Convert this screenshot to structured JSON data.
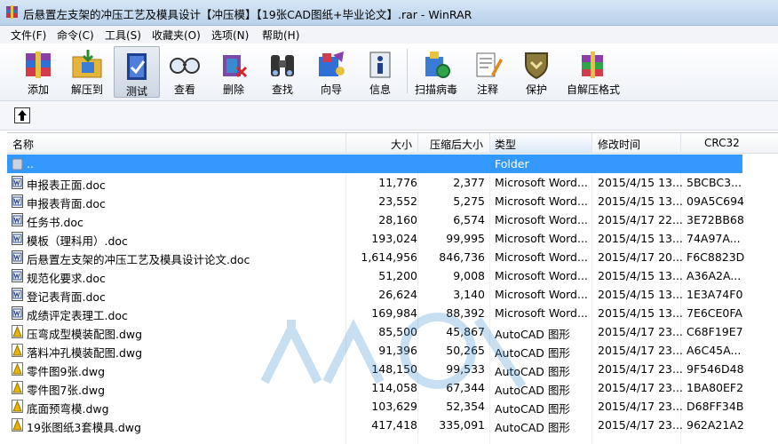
{
  "window": {
    "title": "后悬置左支架的冲压工艺及模具设计【冲压模】【19张CAD图纸+毕业论文】.rar - WinRAR"
  },
  "menu": [
    "文件(F)",
    "命令(C)",
    "工具(S)",
    "收藏夹(O)",
    "选项(N)",
    "帮助(H)"
  ],
  "toolbar": {
    "add": "添加",
    "extract": "解压到",
    "test": "测试",
    "view": "查看",
    "delete": "删除",
    "find": "查找",
    "wizard": "向导",
    "info": "信息",
    "scan": "扫描病毒",
    "comment": "注释",
    "protect": "保护",
    "sfx": "自解压格式"
  },
  "columns": {
    "name": "名称",
    "size": "大小",
    "packed": "压缩后大小",
    "type": "类型",
    "modified": "修改时间",
    "crc": "CRC32"
  },
  "parent_row": {
    "name": "..",
    "type": "Folder"
  },
  "files": [
    {
      "icon": "word-doc-icon",
      "name": "申报表正面.doc",
      "size": "11,776",
      "packed": "2,377",
      "type": "Microsoft Word...",
      "modified": "2015/4/15 13...",
      "crc": "5BCBC3..."
    },
    {
      "icon": "word-doc-icon",
      "name": "申报表背面.doc",
      "size": "23,552",
      "packed": "5,275",
      "type": "Microsoft Word...",
      "modified": "2015/4/15 13...",
      "crc": "09A5C694"
    },
    {
      "icon": "word-doc-icon",
      "name": "任务书.doc",
      "size": "28,160",
      "packed": "6,574",
      "type": "Microsoft Word...",
      "modified": "2015/4/17 22...",
      "crc": "3E72BB68"
    },
    {
      "icon": "word-doc-icon",
      "name": "模板（理科用）.doc",
      "size": "193,024",
      "packed": "99,995",
      "type": "Microsoft Word...",
      "modified": "2015/4/15 13...",
      "crc": "74A97A..."
    },
    {
      "icon": "word-doc-icon",
      "name": "后悬置左支架的冲压工艺及模具设计论文.doc",
      "size": "1,614,956",
      "packed": "846,736",
      "type": "Microsoft Word...",
      "modified": "2015/4/17 20...",
      "crc": "F6C8823D"
    },
    {
      "icon": "word-doc-icon",
      "name": "规范化要求.doc",
      "size": "51,200",
      "packed": "9,008",
      "type": "Microsoft Word...",
      "modified": "2015/4/15 13...",
      "crc": "A36A2A..."
    },
    {
      "icon": "word-doc-icon",
      "name": "登记表背面.doc",
      "size": "26,624",
      "packed": "3,140",
      "type": "Microsoft Word...",
      "modified": "2015/4/15 13...",
      "crc": "1E3A74F0"
    },
    {
      "icon": "word-doc-icon",
      "name": "成绩评定表理工.doc",
      "size": "169,984",
      "packed": "88,392",
      "type": "Microsoft Word...",
      "modified": "2015/4/15 13...",
      "crc": "7E6CE0FA"
    },
    {
      "icon": "autocad-dwg-icon",
      "name": "压弯成型模装配图.dwg",
      "size": "85,500",
      "packed": "45,867",
      "type": "AutoCAD 图形",
      "modified": "2015/4/17 23...",
      "crc": "C68F19E7"
    },
    {
      "icon": "autocad-dwg-icon",
      "name": "落料冲孔模装配图.dwg",
      "size": "91,396",
      "packed": "50,265",
      "type": "AutoCAD 图形",
      "modified": "2015/4/17 23...",
      "crc": "A6C45A..."
    },
    {
      "icon": "autocad-dwg-icon",
      "name": "零件图9张.dwg",
      "size": "148,150",
      "packed": "99,533",
      "type": "AutoCAD 图形",
      "modified": "2015/4/17 23...",
      "crc": "9F546D48"
    },
    {
      "icon": "autocad-dwg-icon",
      "name": "零件图7张.dwg",
      "size": "114,058",
      "packed": "67,344",
      "type": "AutoCAD 图形",
      "modified": "2015/4/17 23...",
      "crc": "1BA80EF2"
    },
    {
      "icon": "autocad-dwg-icon",
      "name": "底面预弯模.dwg",
      "size": "103,629",
      "packed": "52,354",
      "type": "AutoCAD 图形",
      "modified": "2015/4/17 23...",
      "crc": "D68FF34B"
    },
    {
      "icon": "autocad-dwg-icon",
      "name": "19张图纸3套模具.dwg",
      "size": "417,418",
      "packed": "335,091",
      "type": "AutoCAD 图形",
      "modified": "2015/4/17 23...",
      "crc": "962A21A2"
    }
  ],
  "colors": {
    "selection": "#3399ff",
    "titlebar": "#c7dcf2"
  }
}
